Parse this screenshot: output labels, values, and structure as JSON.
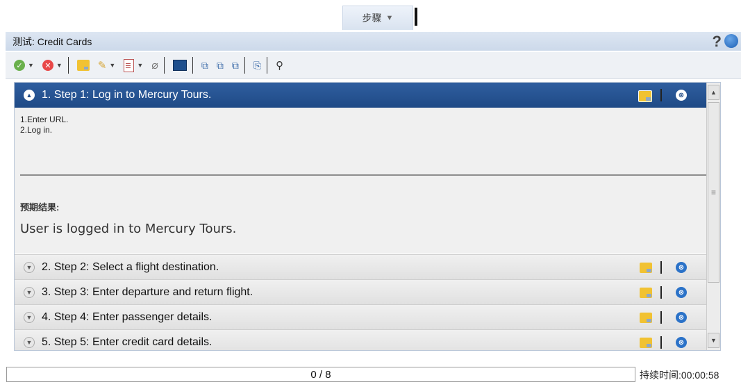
{
  "top_tab": {
    "label": "步骤",
    "arrow": "▼"
  },
  "header": {
    "title": "测试: Credit Cards",
    "help": "?"
  },
  "toolbar": {
    "pass_glyph": "✓",
    "fail_glyph": "✕",
    "dropdown_glyph": "▼",
    "pencil_glyph": "✎",
    "clip_glyph": "⌕",
    "tree_glyphs": [
      "⧉",
      "⧉",
      "⧉"
    ],
    "export_glyph": "⎘",
    "search_glyph": "🔍"
  },
  "steps": [
    {
      "title": "1. Step 1: Log in to Mercury Tours.",
      "toggle": "▲",
      "status": "⚠"
    },
    {
      "title": "2. Step 2: Select a flight destination.",
      "toggle": "▼",
      "status": "⊗"
    },
    {
      "title": "3. Step 3: Enter departure and return flight.",
      "toggle": "▼",
      "status": "⊗"
    },
    {
      "title": "4. Step 4: Enter passenger details.",
      "toggle": "▼",
      "status": "⊗"
    },
    {
      "title": "5. Step 5: Enter credit card details.",
      "toggle": "▼",
      "status": "⊗"
    }
  ],
  "step1_detail": {
    "description": [
      "1.Enter URL.",
      "2.Log in."
    ],
    "expected_label": "预期结果:",
    "expected_text": "User is logged in to Mercury Tours."
  },
  "scrollbar": {
    "up": "▲",
    "down": "▼",
    "grip": "≡"
  },
  "footer": {
    "progress": "0 / 8",
    "duration": "持续时间:00:00:58"
  },
  "colors": {
    "active_header": "#1f4a86",
    "status_blue": "#2b72c8",
    "note_yellow": "#f1c232"
  }
}
